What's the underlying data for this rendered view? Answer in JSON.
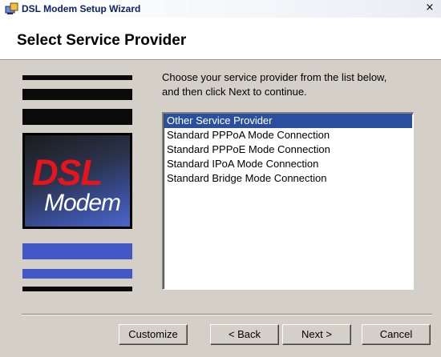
{
  "window": {
    "title": "DSL Modem Setup Wizard",
    "close_symbol": "×",
    "icon": "modem-wizard-icon"
  },
  "header": {
    "title": "Select Service Provider"
  },
  "banner": {
    "logo_line1": "DSL",
    "logo_line2": "Modem"
  },
  "main": {
    "instructions": "Choose your service provider from the list below, and then click Next to continue.",
    "providers": [
      "Other Service Provider",
      "Standard PPPoA Mode Connection",
      "Standard PPPoE Mode Connection",
      "Standard IPoA Mode Connection",
      "Standard Bridge Mode Connection"
    ],
    "selected_index": 0
  },
  "buttons": {
    "customize": "Customize",
    "back": "< Back",
    "next": "Next >",
    "cancel": "Cancel"
  },
  "colors": {
    "selection": "#2a4f9e",
    "title_text": "#0a246a",
    "logo_red": "#e8141c",
    "stripe_dark": "#0b0b0b",
    "stripe_blue": "#4358c4"
  }
}
